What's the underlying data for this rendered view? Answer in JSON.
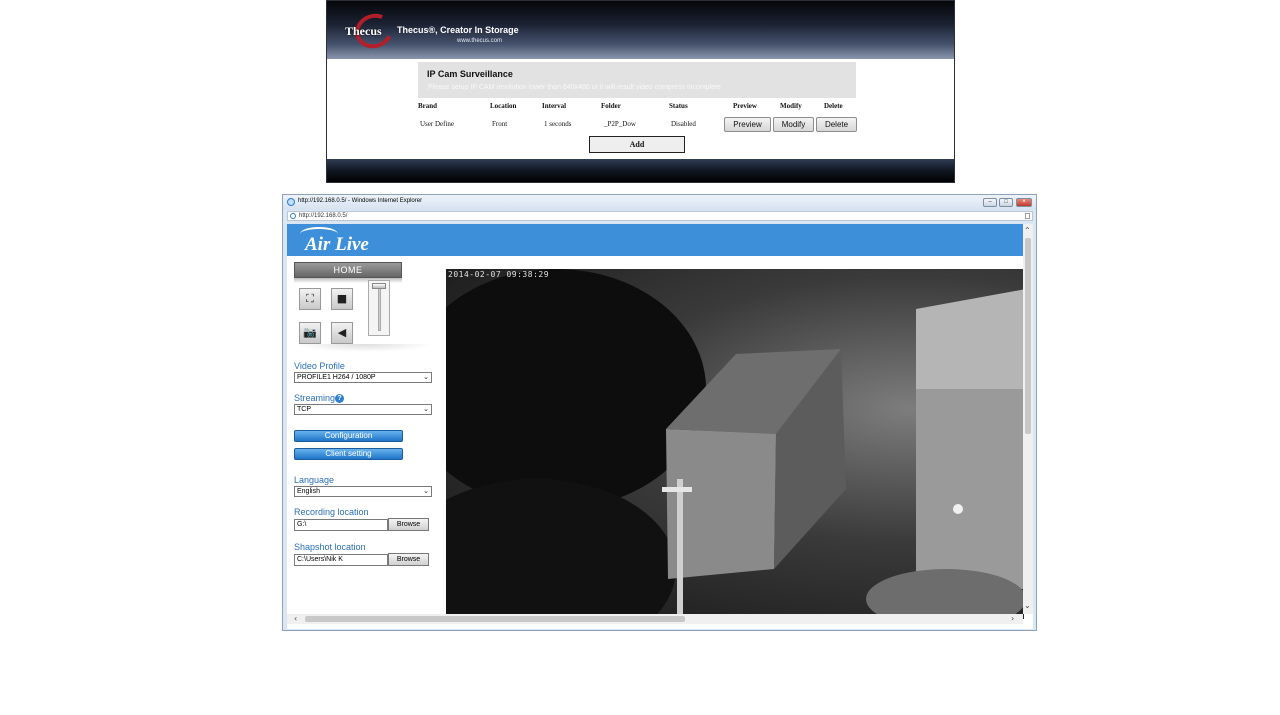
{
  "thecus": {
    "logo_text": "Thecus",
    "tagline": "Thecus®, Creator In Storage",
    "url": "www.thecus.com",
    "section_title": "IP Cam Surveillance",
    "note": "Please setup IP CAM resolution lower than 640x480 or it will result video compress incomplete",
    "columns": [
      "Brand",
      "Location",
      "Interval",
      "Folder",
      "Status",
      "Preview",
      "Modify",
      "Delete"
    ],
    "rows": [
      {
        "brand": "User Define",
        "location": "Front",
        "interval": "1 seconds",
        "folder": "_P2P_Dow",
        "status": "Disabled",
        "preview": "Preview",
        "modify": "Modify",
        "delete": "Delete"
      }
    ],
    "add_label": "Add"
  },
  "ie": {
    "title": "http://192.168.0.5/ - Windows Internet Explorer",
    "address": "http://192.168.0.5/",
    "controls": {
      "minimize": "–",
      "restore": "□",
      "close": "×"
    }
  },
  "airlive": {
    "logo": "Air Live",
    "home_label": "HOME",
    "video_profile_label": "Video Profile",
    "video_profile_value": "PROFILE1 H264 / 1080P",
    "streaming_label": "Streaming",
    "streaming_value": "TCP",
    "configuration_label": "Configuration",
    "client_setting_label": "Client setting",
    "language_label": "Language",
    "language_value": "English",
    "recording_label": "Recording location",
    "recording_value": "G:\\",
    "snapshot_label": "Shapshot location",
    "snapshot_value": "C:\\Users\\Nik K",
    "browse_label": "Browse",
    "timestamp": "2014-02-07 09:38:29"
  },
  "icons": {
    "fullscreen": "⛶",
    "stop": "■",
    "snapshot": "📷",
    "speaker": "◀",
    "help": "?",
    "dropdown": "⌄",
    "scroll_up": "⌃",
    "scroll_down": "⌄",
    "scroll_left": "‹",
    "scroll_right": "›"
  },
  "colors": {
    "airlive_blue": "#3d8fd9",
    "label_blue": "#2b6fb5",
    "thecus_red": "#b31e2b"
  }
}
